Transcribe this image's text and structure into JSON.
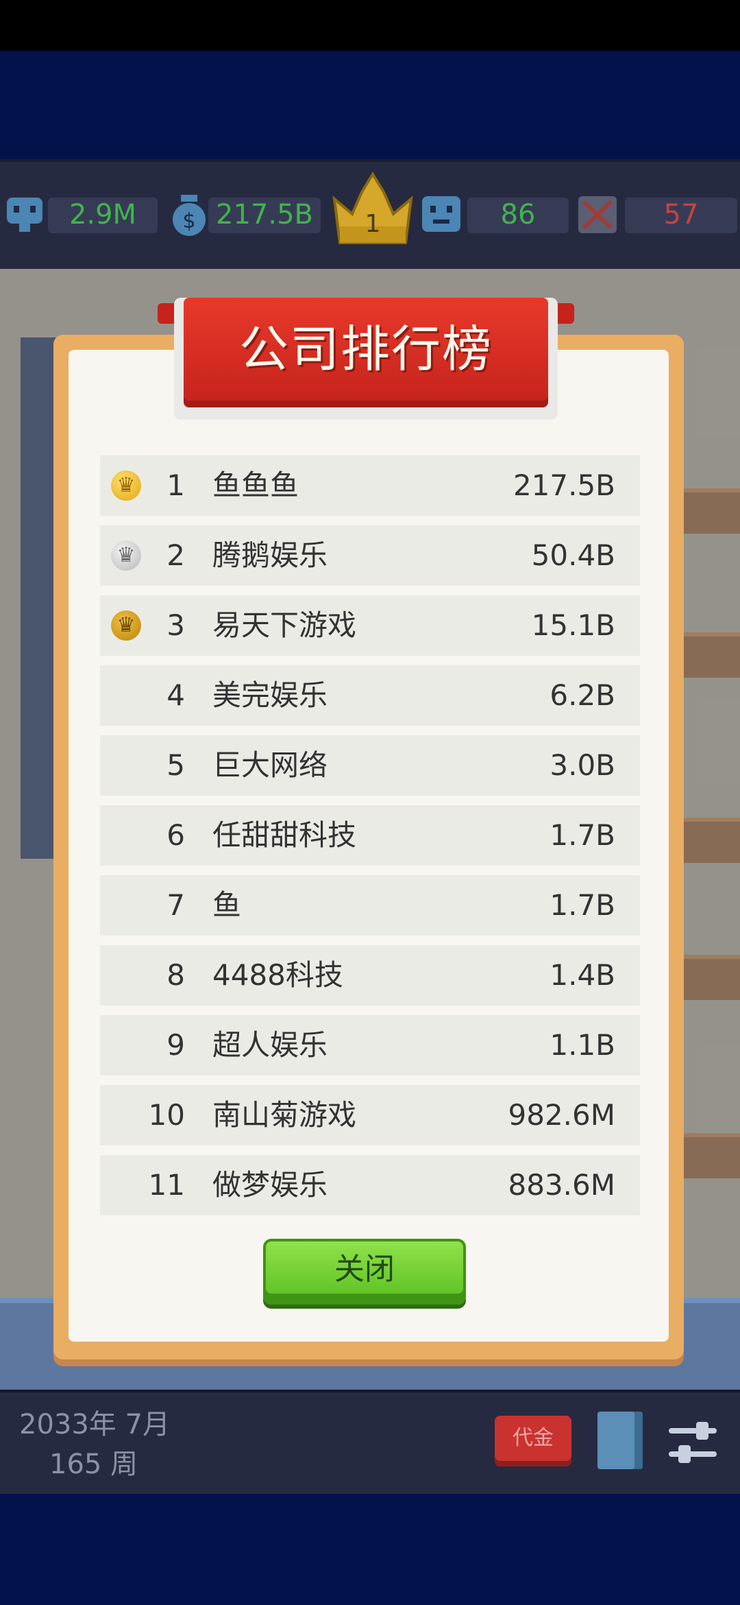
{
  "status_bar": {
    "fans_value": "2.9M",
    "money_value": "217.5B",
    "rank_value": "1",
    "staff_value": "86",
    "bugs_value": "57",
    "icons": [
      "fans-icon",
      "money-bag-icon",
      "crown-icon",
      "employee-icon",
      "bug-icon"
    ]
  },
  "dialog": {
    "title": "公司排行榜",
    "rows": [
      {
        "rank": "1",
        "name": "鱼鱼鱼",
        "value": "217.5B",
        "medal": "gold"
      },
      {
        "rank": "2",
        "name": "腾鹅娱乐",
        "value": "50.4B",
        "medal": "silver"
      },
      {
        "rank": "3",
        "name": "易天下游戏",
        "value": "15.1B",
        "medal": "bronze"
      },
      {
        "rank": "4",
        "name": "美完娱乐",
        "value": "6.2B",
        "medal": ""
      },
      {
        "rank": "5",
        "name": "巨大网络",
        "value": "3.0B",
        "medal": ""
      },
      {
        "rank": "6",
        "name": "任甜甜科技",
        "value": "1.7B",
        "medal": ""
      },
      {
        "rank": "7",
        "name": "鱼",
        "value": "1.7B",
        "medal": ""
      },
      {
        "rank": "8",
        "name": "4488科技",
        "value": "1.4B",
        "medal": ""
      },
      {
        "rank": "9",
        "name": "超人娱乐",
        "value": "1.1B",
        "medal": ""
      },
      {
        "rank": "10",
        "name": "南山菊游戏",
        "value": "982.6M",
        "medal": ""
      },
      {
        "rank": "11",
        "name": "做梦娱乐",
        "value": "883.6M",
        "medal": ""
      }
    ],
    "close_label": "关闭"
  },
  "bottom_bar": {
    "date": "2033年 7月",
    "week": "165 周",
    "voucher_label": "代金",
    "icons": [
      "voucher-icon",
      "book-icon",
      "settings-sliders-icon"
    ]
  },
  "colors": {
    "accent_green": "#3fb54a",
    "accent_red": "#c9423f",
    "banner_red": "#d82e22",
    "button_green": "#6fd02f"
  }
}
